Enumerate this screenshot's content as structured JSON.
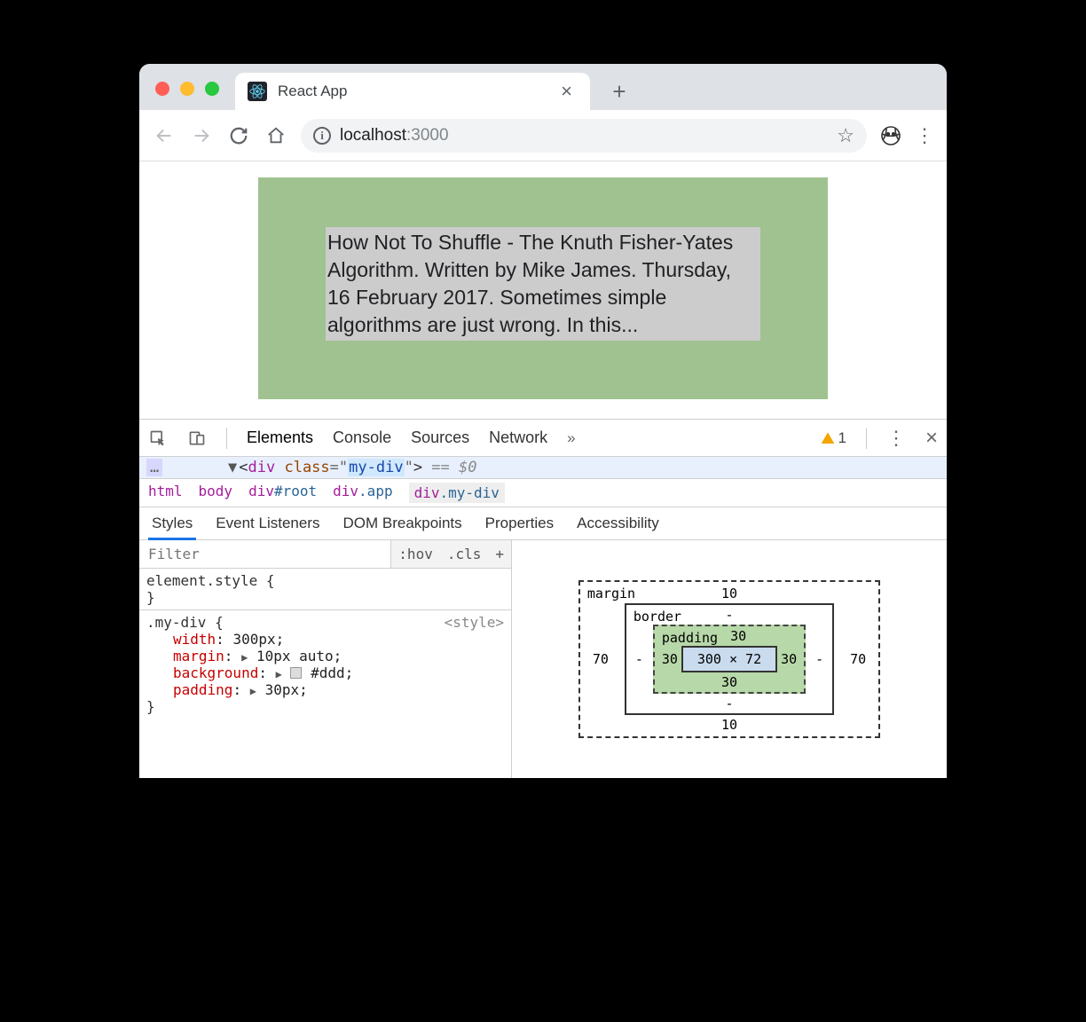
{
  "tab": {
    "title": "React App"
  },
  "url": {
    "host": "localhost",
    "port": ":3000"
  },
  "page": {
    "article_text": "How Not To Shuffle - The Knuth Fisher-Yates Algorithm. Written by Mike James. Thursday, 16 February 2017. Sometimes simple algorithms are just wrong. In this..."
  },
  "devtools": {
    "tabs": [
      "Elements",
      "Console",
      "Sources",
      "Network"
    ],
    "active_tab": "Elements",
    "warnings": "1",
    "source_line": {
      "tagname": "div",
      "attrname": "class",
      "attrval": "my-div",
      "suffix": " == $0"
    },
    "breadcrumb": [
      "html",
      "body",
      "div#root",
      "div.app",
      "div.my-div"
    ],
    "subtabs": [
      "Styles",
      "Event Listeners",
      "DOM Breakpoints",
      "Properties",
      "Accessibility"
    ],
    "active_subtab": "Styles",
    "filter": {
      "placeholder": "Filter",
      "hov": ":hov",
      "cls": ".cls",
      "plus": "+"
    },
    "rules": {
      "element_style_header": "element.style {",
      "element_style_close": "}",
      "mydiv": {
        "selector_line": ".my-div {",
        "source": "<style>",
        "props": [
          {
            "name": "width",
            "value": "300px;"
          },
          {
            "name": "margin",
            "value": "10px auto;",
            "expandable": true
          },
          {
            "name": "background",
            "value": "#ddd;",
            "expandable": true,
            "swatch": true
          },
          {
            "name": "padding",
            "value": "30px;",
            "expandable": true
          }
        ],
        "close": "}"
      }
    },
    "boxmodel": {
      "margin_label": "margin",
      "margin": {
        "top": "10",
        "right": "70",
        "bottom": "10",
        "left": "70"
      },
      "border_label": "border",
      "border": {
        "top": "-",
        "right": "-",
        "bottom": "-",
        "left": "-"
      },
      "padding_label": "padding",
      "padding": {
        "top": "30",
        "right": "30",
        "bottom": "30",
        "left": "30"
      },
      "content": "300 × 72"
    }
  }
}
